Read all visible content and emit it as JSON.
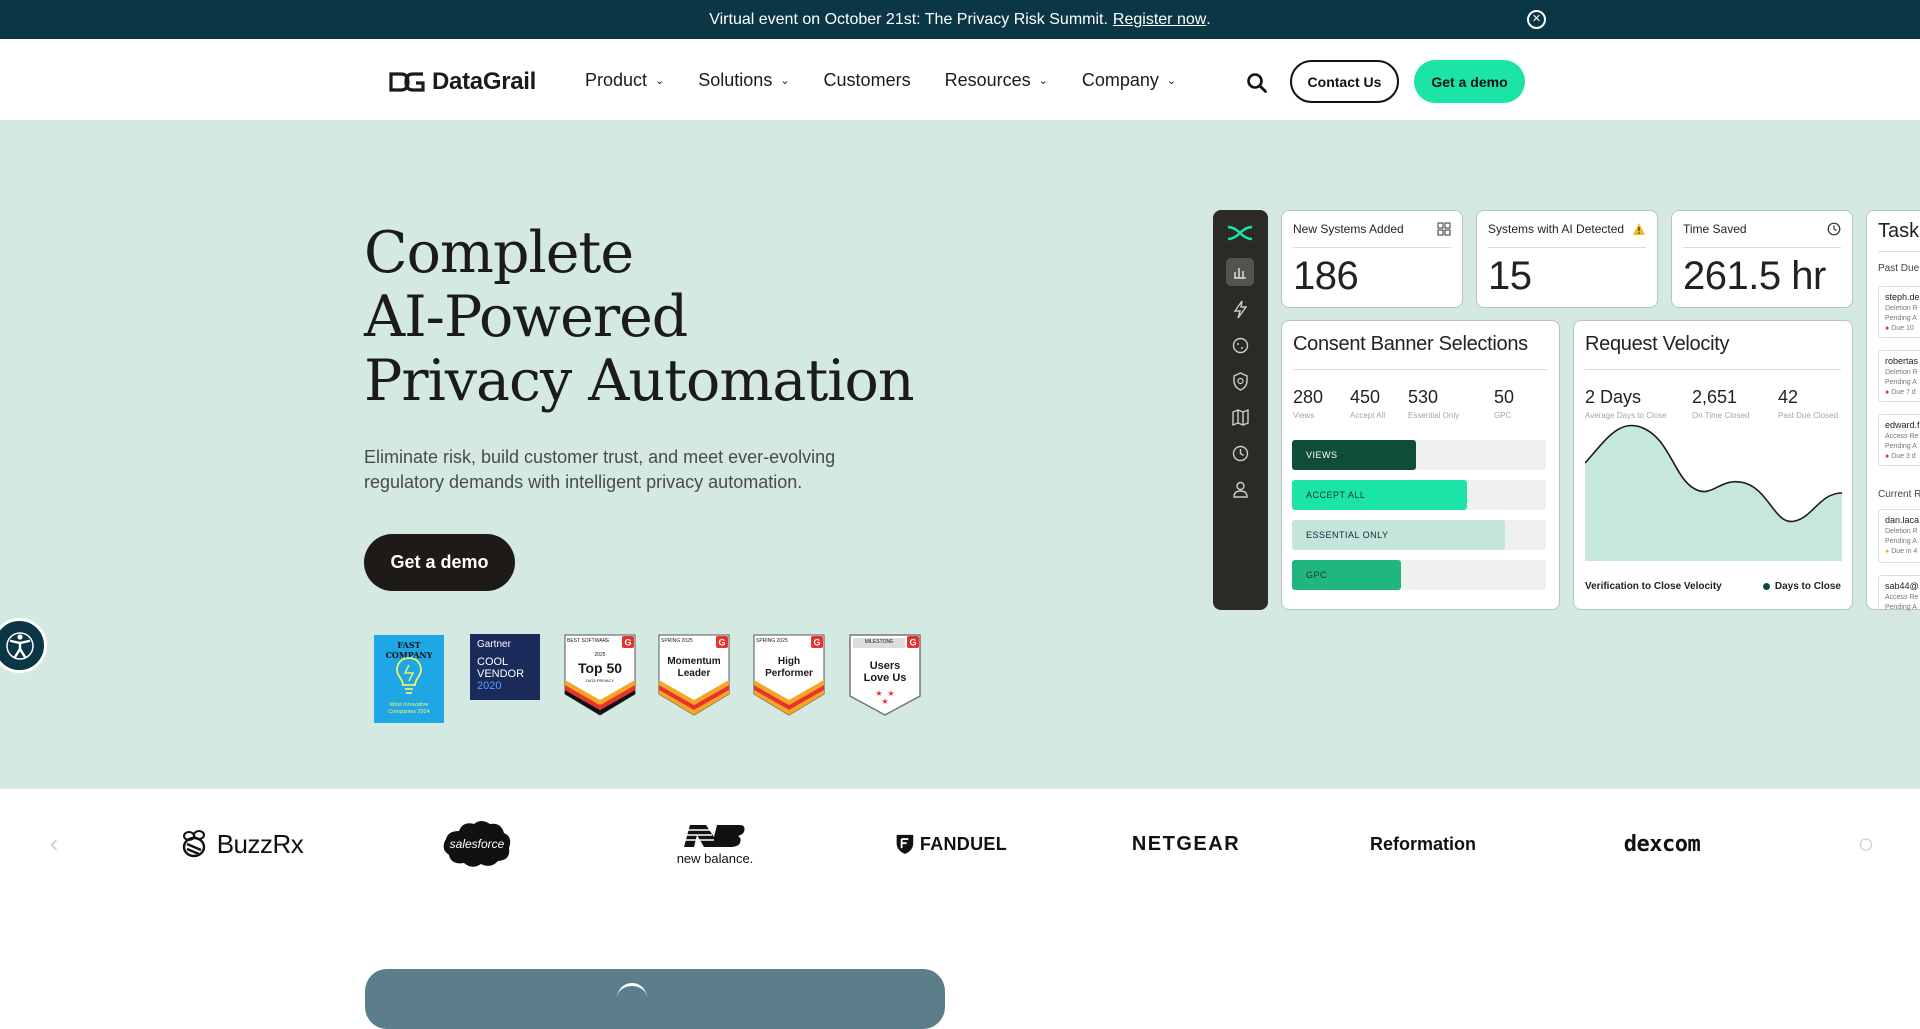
{
  "announcement": {
    "text": "Virtual event on October 21st: The Privacy Risk Summit.",
    "link": "Register now",
    "suffix": ".",
    "close_icon": "close-circle-icon"
  },
  "header": {
    "brand": "DataGrail",
    "nav": [
      {
        "label": "Product",
        "has_dropdown": true
      },
      {
        "label": "Solutions",
        "has_dropdown": true
      },
      {
        "label": "Customers",
        "has_dropdown": false
      },
      {
        "label": "Resources",
        "has_dropdown": true
      },
      {
        "label": "Company",
        "has_dropdown": true
      }
    ],
    "search_icon": "search-icon",
    "contact_label": "Contact Us",
    "demo_label": "Get a demo"
  },
  "hero": {
    "title_lines": [
      "Complete",
      "AI-Powered",
      "Privacy Automation"
    ],
    "subtitle": "Eliminate risk, build customer trust, and meet ever-evolving regulatory demands with intelligent privacy automation.",
    "cta_label": "Get a demo",
    "badges": [
      {
        "name": "FAST COMPANY",
        "caption": "Most Innovative Companies 2024"
      },
      {
        "name": "Gartner",
        "line1": "COOL",
        "line2": "VENDOR",
        "year": "2020"
      },
      {
        "top": "BEST SOFTWARE",
        "year": "2025",
        "title": "Top 50",
        "foot": "DATA PRIVACY"
      },
      {
        "top": "SPRING 2025",
        "title1": "Momentum",
        "title2": "Leader"
      },
      {
        "top": "SPRING 2025",
        "title1": "High",
        "title2": "Performer"
      },
      {
        "top": "MILESTONE",
        "title1": "Users",
        "title2": "Love Us"
      }
    ]
  },
  "dashboard": {
    "sidebar_icons": [
      "datagrail-logo-icon",
      "bar-chart-icon",
      "lightning-icon",
      "cookie-icon",
      "shield-icon",
      "map-icon",
      "clock-icon",
      "user-icon"
    ],
    "kpis": [
      {
        "title": "New Systems Added",
        "value": "186",
        "icon": "grid-icon"
      },
      {
        "title": "Systems with AI Detected",
        "value": "15",
        "icon": "warning-icon"
      },
      {
        "title": "Time Saved",
        "value": "261.5 hr",
        "icon": "clock-icon"
      }
    ],
    "consent": {
      "title": "Consent Banner Selections",
      "stats": [
        {
          "value": "280",
          "label": "Views"
        },
        {
          "value": "450",
          "label": "Accept All"
        },
        {
          "value": "530",
          "label": "Essential Only"
        },
        {
          "value": "50",
          "label": "GPC"
        }
      ],
      "bars": [
        {
          "label": "VIEWS",
          "fraction": 0.49,
          "color": "#0f4d3a",
          "text_color": "#ffffff"
        },
        {
          "label": "ACCEPT ALL",
          "fraction": 0.69,
          "color": "#1ce4a6",
          "text_color": "#0d3b2e"
        },
        {
          "label": "ESSENTIAL ONLY",
          "fraction": 0.84,
          "color": "#c4e6da",
          "text_color": "#224"
        },
        {
          "label": "GPC",
          "fraction": 0.43,
          "color": "#22b67f",
          "text_color": "#0d3b2e"
        }
      ]
    },
    "velocity": {
      "title": "Request Velocity",
      "stats": [
        {
          "value": "2 Days",
          "label": "Average Days to Close"
        },
        {
          "value": "2,651",
          "label": "On Time Closed"
        },
        {
          "value": "42",
          "label": "Past Due Closed"
        }
      ],
      "footer_left": "Verification to Close Velocity",
      "legend": "Days to Close"
    },
    "tasks": {
      "title": "Tasks",
      "section1": "Past Due",
      "items1": [
        {
          "name": "steph.de",
          "type": "Deletion R",
          "status": "Pending A",
          "due": "Due 10"
        },
        {
          "name": "robertas",
          "type": "Deletion R",
          "status": "Pending A",
          "due": "Due 7 d"
        },
        {
          "name": "edward.f",
          "type": "Access Re",
          "status": "Pending A",
          "due": "Due 3 d"
        }
      ],
      "section2": "Current R",
      "items2": [
        {
          "name": "dan.laca",
          "type": "Deletion R",
          "status": "Pending A",
          "due": "Due in 4"
        },
        {
          "name": "sab44@",
          "type": "Access Re",
          "status": "Pending A",
          "due": ""
        }
      ]
    }
  },
  "customer_logos": [
    "BuzzRx",
    "salesforce",
    "new balance.",
    "FANDUEL",
    "NETGEAR",
    "Reformation",
    "dexcom"
  ],
  "colors": {
    "announcement_bg": "#0a3646",
    "hero_bg": "#d3e9e1",
    "accent": "#1ce4a6",
    "dark_button": "#1d1a17"
  }
}
